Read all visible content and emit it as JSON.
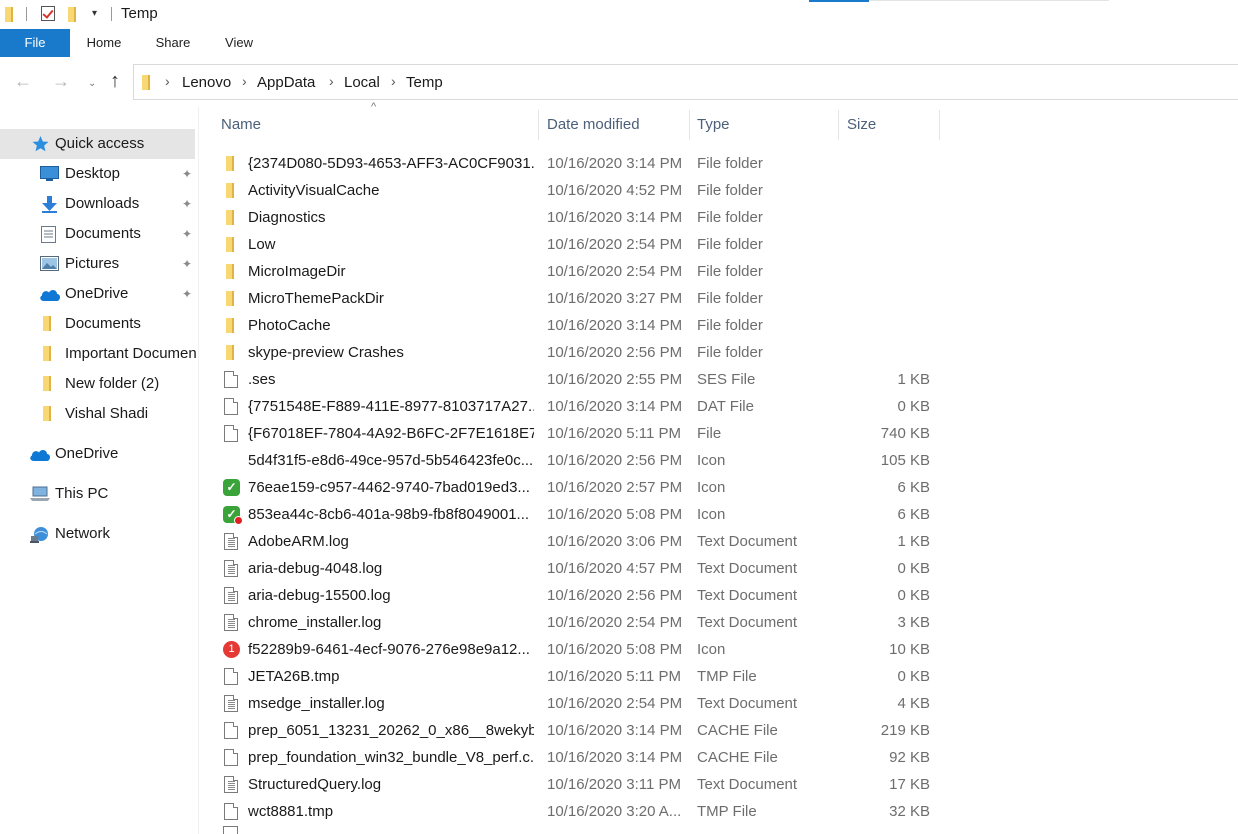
{
  "window": {
    "title": "Temp",
    "qat_dropdown": "▾"
  },
  "ribbon": {
    "tabs": [
      {
        "label": "File"
      },
      {
        "label": "Home"
      },
      {
        "label": "Share"
      },
      {
        "label": "View"
      }
    ]
  },
  "nav_buttons": {
    "back": "←",
    "forward": "→",
    "recent": "⌄",
    "up": "↑"
  },
  "address": {
    "separator": "›",
    "crumbs": [
      "Lenovo",
      "AppData",
      "Local",
      "Temp"
    ]
  },
  "sidebar": {
    "items": [
      {
        "label": "Quick access",
        "icon": "star-icon",
        "selected": true
      },
      {
        "label": "Desktop",
        "icon": "desktop-icon",
        "pinned": true
      },
      {
        "label": "Downloads",
        "icon": "download-icon",
        "pinned": true
      },
      {
        "label": "Documents",
        "icon": "documents-icon",
        "pinned": true
      },
      {
        "label": "Pictures",
        "icon": "pictures-icon",
        "pinned": true
      },
      {
        "label": "OneDrive",
        "icon": "cloud-icon",
        "pinned": true
      },
      {
        "label": "Documents",
        "icon": "folder-icon"
      },
      {
        "label": "Important Documents",
        "icon": "folder-icon"
      },
      {
        "label": "New folder (2)",
        "icon": "folder-icon"
      },
      {
        "label": "Vishal Shadi",
        "icon": "folder-icon"
      },
      {
        "label": "OneDrive",
        "icon": "cloud-icon"
      },
      {
        "label": "This PC",
        "icon": "computer-icon"
      },
      {
        "label": "Network",
        "icon": "network-icon"
      }
    ],
    "pin_glyph": "📌"
  },
  "columns": {
    "name": "Name",
    "date": "Date modified",
    "type": "Type",
    "size": "Size",
    "sort_indicator": "^"
  },
  "files": [
    {
      "name": "{2374D080-5D93-4653-AFF3-AC0CF9031...",
      "date": "10/16/2020 3:14 PM",
      "type": "File folder",
      "size": "",
      "icon": "folder"
    },
    {
      "name": "ActivityVisualCache",
      "date": "10/16/2020 4:52 PM",
      "type": "File folder",
      "size": "",
      "icon": "folder"
    },
    {
      "name": "Diagnostics",
      "date": "10/16/2020 3:14 PM",
      "type": "File folder",
      "size": "",
      "icon": "folder"
    },
    {
      "name": "Low",
      "date": "10/16/2020 2:54 PM",
      "type": "File folder",
      "size": "",
      "icon": "folder"
    },
    {
      "name": "MicroImageDir",
      "date": "10/16/2020 2:54 PM",
      "type": "File folder",
      "size": "",
      "icon": "folder"
    },
    {
      "name": "MicroThemePackDir",
      "date": "10/16/2020 3:27 PM",
      "type": "File folder",
      "size": "",
      "icon": "folder"
    },
    {
      "name": "PhotoCache",
      "date": "10/16/2020 3:14 PM",
      "type": "File folder",
      "size": "",
      "icon": "folder"
    },
    {
      "name": "skype-preview Crashes",
      "date": "10/16/2020 2:56 PM",
      "type": "File folder",
      "size": "",
      "icon": "folder"
    },
    {
      "name": ".ses",
      "date": "10/16/2020 2:55 PM",
      "type": "SES File",
      "size": "1 KB",
      "icon": "file"
    },
    {
      "name": "{7751548E-F889-411E-8977-8103717A27...",
      "date": "10/16/2020 3:14 PM",
      "type": "DAT File",
      "size": "0 KB",
      "icon": "file"
    },
    {
      "name": "{F67018EF-7804-4A92-B6FC-2F7E1618E7...",
      "date": "10/16/2020 5:11 PM",
      "type": "File",
      "size": "740 KB",
      "icon": "file"
    },
    {
      "name": "5d4f31f5-e8d6-49ce-957d-5b546423fe0c...",
      "date": "10/16/2020 2:56 PM",
      "type": "Icon",
      "size": "105 KB",
      "icon": "none"
    },
    {
      "name": "76eae159-c957-4462-9740-7bad019ed3...",
      "date": "10/16/2020 2:57 PM",
      "type": "Icon",
      "size": "6 KB",
      "icon": "check"
    },
    {
      "name": "853ea44c-8cb6-401a-98b9-fb8f8049001...",
      "date": "10/16/2020 5:08 PM",
      "type": "Icon",
      "size": "6 KB",
      "icon": "check-dot"
    },
    {
      "name": "AdobeARM.log",
      "date": "10/16/2020 3:06 PM",
      "type": "Text Document",
      "size": "1 KB",
      "icon": "text"
    },
    {
      "name": "aria-debug-4048.log",
      "date": "10/16/2020 4:57 PM",
      "type": "Text Document",
      "size": "0 KB",
      "icon": "text"
    },
    {
      "name": "aria-debug-15500.log",
      "date": "10/16/2020 2:56 PM",
      "type": "Text Document",
      "size": "0 KB",
      "icon": "text"
    },
    {
      "name": "chrome_installer.log",
      "date": "10/16/2020 2:54 PM",
      "type": "Text Document",
      "size": "3 KB",
      "icon": "text"
    },
    {
      "name": "f52289b9-6461-4ecf-9076-276e98e9a12...",
      "date": "10/16/2020 5:08 PM",
      "type": "Icon",
      "size": "10 KB",
      "icon": "badge",
      "badge": "1"
    },
    {
      "name": "JETA26B.tmp",
      "date": "10/16/2020 5:11 PM",
      "type": "TMP File",
      "size": "0 KB",
      "icon": "file"
    },
    {
      "name": "msedge_installer.log",
      "date": "10/16/2020 2:54 PM",
      "type": "Text Document",
      "size": "4 KB",
      "icon": "text"
    },
    {
      "name": "prep_6051_13231_20262_0_x86__8wekyb...",
      "date": "10/16/2020 3:14 PM",
      "type": "CACHE File",
      "size": "219 KB",
      "icon": "file"
    },
    {
      "name": "prep_foundation_win32_bundle_V8_perf.c...",
      "date": "10/16/2020 3:14 PM",
      "type": "CACHE File",
      "size": "92 KB",
      "icon": "file"
    },
    {
      "name": "StructuredQuery.log",
      "date": "10/16/2020 3:11 PM",
      "type": "Text Document",
      "size": "17 KB",
      "icon": "text"
    },
    {
      "name": "wct8881.tmp",
      "date": "10/16/2020 3:20 A...",
      "type": "TMP File",
      "size": "32 KB",
      "icon": "file"
    }
  ],
  "colors": {
    "accent": "#1979ca",
    "selected_bg": "#e5e5e5",
    "header_text": "#4c607a",
    "folder": "#f8d775"
  }
}
